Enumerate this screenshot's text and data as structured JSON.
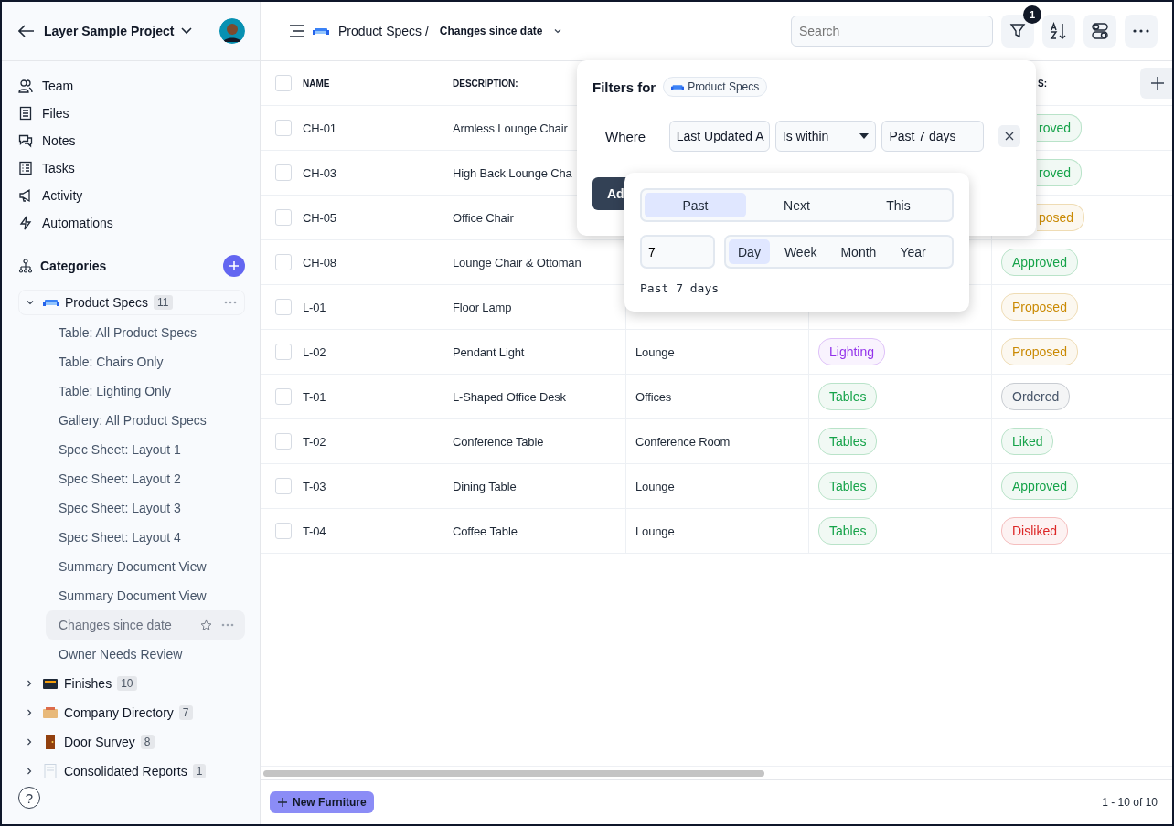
{
  "sidebar": {
    "project": "Layer Sample Project",
    "nav": [
      {
        "label": "Team"
      },
      {
        "label": "Files"
      },
      {
        "label": "Notes"
      },
      {
        "label": "Tasks"
      },
      {
        "label": "Activity"
      },
      {
        "label": "Automations"
      }
    ],
    "categories_title": "Categories",
    "categories": [
      {
        "label": "Product Specs",
        "count": "11",
        "expanded": true,
        "children": [
          {
            "label": "Table: All Product Specs",
            "selected": false
          },
          {
            "label": "Table: Chairs Only",
            "selected": false
          },
          {
            "label": "Table: Lighting Only",
            "selected": false
          },
          {
            "label": "Gallery: All Product Specs",
            "selected": false
          },
          {
            "label": "Spec Sheet: Layout 1",
            "selected": false
          },
          {
            "label": "Spec Sheet: Layout 2",
            "selected": false
          },
          {
            "label": "Spec Sheet: Layout 3",
            "selected": false
          },
          {
            "label": "Spec Sheet: Layout 4",
            "selected": false
          },
          {
            "label": "Summary Document View",
            "selected": false
          },
          {
            "label": "Summary Document View",
            "selected": false
          },
          {
            "label": "Changes since date",
            "selected": true
          },
          {
            "label": "Owner Needs Review",
            "selected": false
          }
        ]
      },
      {
        "label": "Finishes",
        "count": "10",
        "expanded": false
      },
      {
        "label": "Company Directory",
        "count": "7",
        "expanded": false
      },
      {
        "label": "Door Survey",
        "count": "8",
        "expanded": false
      },
      {
        "label": "Consolidated Reports",
        "count": "1",
        "expanded": false
      }
    ],
    "help": "?"
  },
  "toolbar": {
    "breadcrumb": "Product Specs /",
    "view": "Changes since date",
    "search": {
      "placeholder": "Search"
    },
    "filter_count": "1"
  },
  "table": {
    "all_checked": false,
    "columns": [
      "NAME",
      "DESCRIPTION:",
      null,
      null,
      "S:"
    ],
    "rows": [
      {
        "checked": false,
        "cells": [
          "CH-01",
          "Armless Lounge Chair",
          null,
          null,
          {
            "text": "roved",
            "color": "#16a34a"
          }
        ]
      },
      {
        "checked": false,
        "cells": [
          "CH-03",
          "High Back Lounge Cha",
          null,
          null,
          {
            "text": "roved",
            "color": "#16a34a"
          }
        ]
      },
      {
        "checked": false,
        "cells": [
          "CH-05",
          "Office Chair",
          null,
          null,
          {
            "text": "posed",
            "color": "#ca8a04"
          }
        ]
      },
      {
        "checked": false,
        "cells": [
          "CH-08",
          "Lounge Chair & Ottoman",
          null,
          null,
          {
            "text": "Approved",
            "color": "#16a34a"
          }
        ]
      },
      {
        "checked": false,
        "cells": [
          "L-01",
          "Floor Lamp",
          null,
          null,
          {
            "text": "Proposed",
            "color": "#ca8a04"
          }
        ]
      },
      {
        "checked": false,
        "cells": [
          "L-02",
          "Pendant Light",
          "Lounge",
          {
            "text": "Lighting",
            "color": "#9333ea"
          },
          {
            "text": "Proposed",
            "color": "#ca8a04"
          }
        ]
      },
      {
        "checked": false,
        "cells": [
          "T-01",
          "L-Shaped Office Desk",
          "Offices",
          {
            "text": "Tables",
            "color": "#16a34a"
          },
          {
            "text": "Ordered",
            "color": "#475569"
          }
        ]
      },
      {
        "checked": false,
        "cells": [
          "T-02",
          "Conference Table",
          "Conference Room",
          {
            "text": "Tables",
            "color": "#16a34a"
          },
          {
            "text": "Liked",
            "color": "#16a34a"
          }
        ]
      },
      {
        "checked": false,
        "cells": [
          "T-03",
          "Dining Table",
          "Lounge",
          {
            "text": "Tables",
            "color": "#16a34a"
          },
          {
            "text": "Approved",
            "color": "#16a34a"
          }
        ]
      },
      {
        "checked": false,
        "cells": [
          "T-04",
          "Coffee Table",
          "Lounge",
          {
            "text": "Tables",
            "color": "#16a34a"
          },
          {
            "text": "Disliked",
            "color": "#dc2626"
          }
        ]
      }
    ]
  },
  "footer": {
    "new_button": "New Furniture",
    "pagination": "1 - 10 of 10"
  },
  "filter_panel": {
    "title": "Filters for",
    "chip": "Product Specs",
    "where": "Where",
    "field": "Last Updated A",
    "operator": "Is within",
    "value": "Past 7 days",
    "add_button": "Ad"
  },
  "date_picker": {
    "modes": [
      {
        "label": "Past",
        "selected": true
      },
      {
        "label": "Next",
        "selected": false
      },
      {
        "label": "This",
        "selected": false
      }
    ],
    "amount": "7",
    "units": [
      {
        "label": "Day",
        "selected": true
      },
      {
        "label": "Week",
        "selected": false
      },
      {
        "label": "Month",
        "selected": false
      },
      {
        "label": "Year",
        "selected": false
      }
    ],
    "summary": "Past 7 days"
  }
}
